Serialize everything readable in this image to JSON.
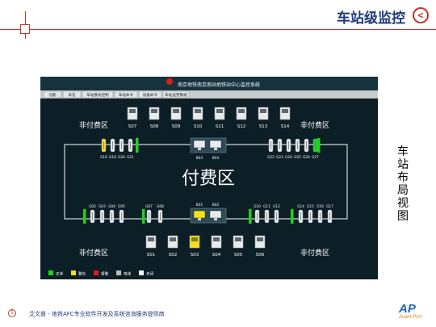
{
  "page": {
    "title": "车站级监控",
    "side_label": "车站布局视图",
    "footer_number": "5",
    "footer_text": "艾文普 - 地铁AFC专业软件开发及系统咨询服务提供商",
    "logo_main": "AP",
    "logo_sub": "Avant-Port"
  },
  "screen": {
    "header_title": "南京地铁南京南站地铁站中心监控系统",
    "toolbar": [
      "功能",
      "日志",
      "车站模式控制",
      "车站命令",
      "设备命令",
      "车站运营数据"
    ],
    "top_devices": [
      "S07",
      "S08",
      "S09",
      "S10",
      "S11",
      "S12",
      "S13",
      "S14"
    ],
    "bottom_devices": [
      "S01",
      "S02",
      "S03",
      "S04",
      "S05",
      "S06"
    ],
    "bottom_warn_device": "S03",
    "zone_nonpaid_tl": "非付费区",
    "zone_nonpaid_tr": "非付费区",
    "zone_nonpaid_bl": "非付费区",
    "zone_nonpaid_br": "非付费区",
    "zone_paid": "付费区",
    "gates_top_left": [
      "G19",
      "G18",
      "G20",
      "G21"
    ],
    "gates_top_right": [
      "G22",
      "G23",
      "G24",
      "G25",
      "G26",
      "G27"
    ],
    "gates_bottom": [
      "G02",
      "G03",
      "G04",
      "G05",
      "G07",
      "G08",
      "G10",
      "G11",
      "G12",
      "G14",
      "G15",
      "G16",
      "G17"
    ],
    "bom_top": [
      "B03",
      "B04"
    ],
    "bom_bottom": [
      "B01",
      "B02"
    ],
    "legend": [
      {
        "label": "正常",
        "color": "#19d619"
      },
      {
        "label": "警告",
        "color": "#f4e11a"
      },
      {
        "label": "报警",
        "color": "#e21b1b"
      },
      {
        "label": "离线",
        "color": "#bdbdbd"
      },
      {
        "label": "关闭",
        "color": "#ffffff"
      }
    ],
    "colors": {
      "normal": "#19d619",
      "warning": "#f4e11a",
      "alarm": "#e21b1b"
    }
  }
}
